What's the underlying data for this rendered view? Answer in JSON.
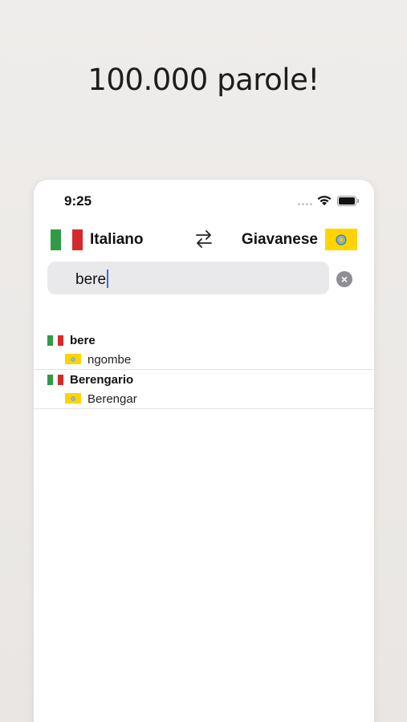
{
  "headline": "100.000 parole!",
  "status_bar": {
    "time": "9:25"
  },
  "languages": {
    "source": "Italiano",
    "target": "Giavanese"
  },
  "search": {
    "value": "bere"
  },
  "results": [
    {
      "word": "bere",
      "translation": "ngombe"
    },
    {
      "word": "Berengario",
      "translation": "Berengar"
    }
  ],
  "colors": {
    "italy_green": "#2f9b46",
    "italy_red": "#d52a2a",
    "javanese_yellow": "#ffd400",
    "cursor_blue": "#2f6ee8"
  },
  "icons": {
    "swap": "swap-arrows-icon",
    "clear": "clear-circle-icon"
  }
}
